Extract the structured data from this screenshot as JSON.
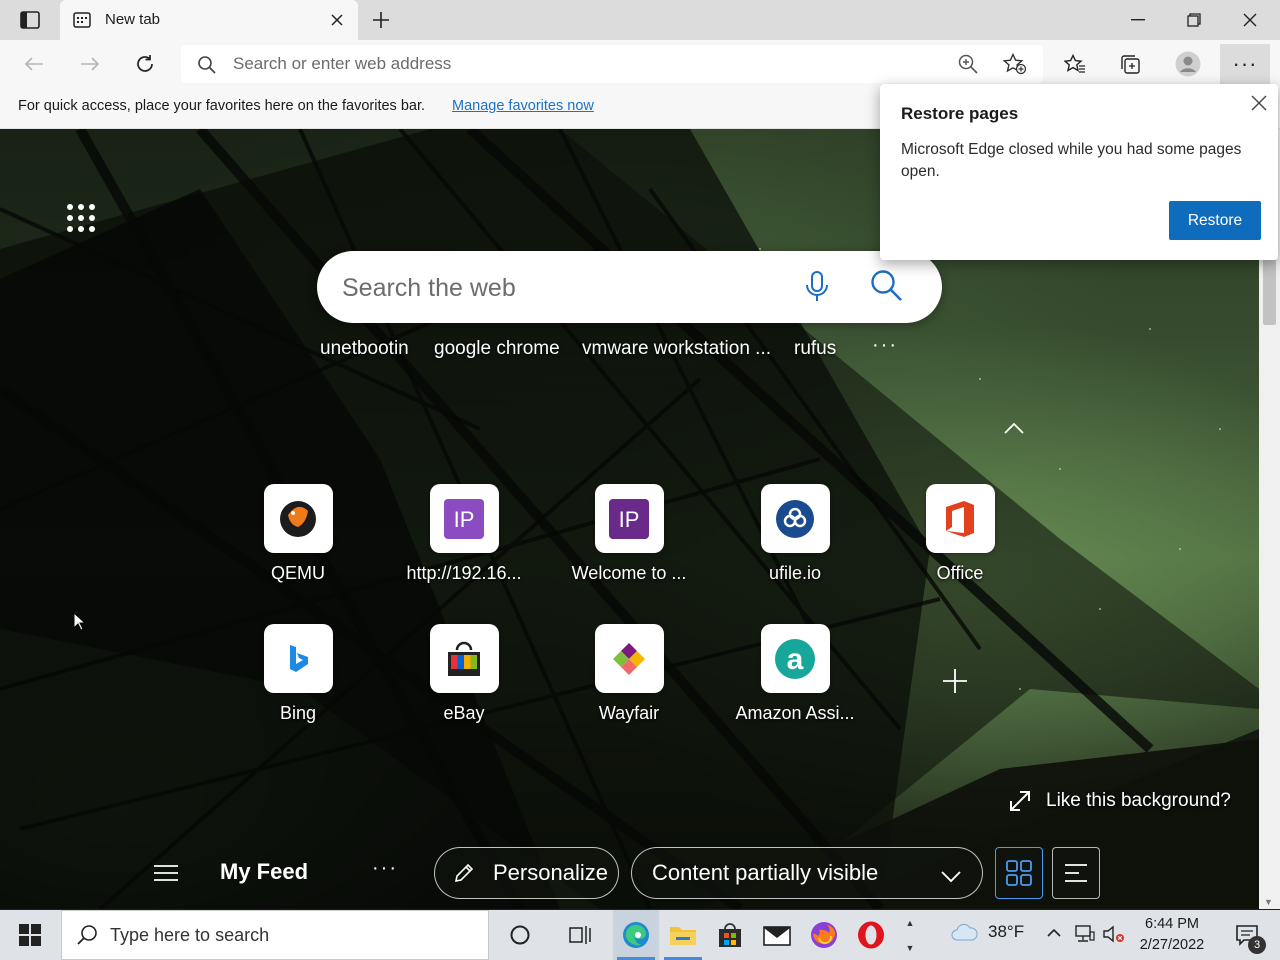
{
  "browser": {
    "tab": {
      "title": "New tab"
    },
    "address_bar": {
      "placeholder": "Search or enter web address"
    },
    "favorites_bar": {
      "message": "For quick access, place your favorites here on the favorites bar.",
      "link": "Manage favorites now"
    }
  },
  "new_tab_page": {
    "search": {
      "placeholder": "Search the web"
    },
    "trending": [
      "unetbootin",
      "google chrome",
      "vmware workstation ...",
      "rufus"
    ],
    "trending_more": "···",
    "quick_links": [
      {
        "label": "QEMU",
        "icon": "qemu-icon"
      },
      {
        "label": "http://192.16...",
        "icon": "ip-icon"
      },
      {
        "label": "Welcome to ...",
        "icon": "ip-icon"
      },
      {
        "label": "ufile.io",
        "icon": "ufile-icon"
      },
      {
        "label": "Office",
        "icon": "office-icon"
      },
      {
        "label": "Bing",
        "icon": "bing-icon"
      },
      {
        "label": "eBay",
        "icon": "ebay-icon"
      },
      {
        "label": "Wayfair",
        "icon": "wayfair-icon"
      },
      {
        "label": "Amazon Assi...",
        "icon": "amazon-assistant-icon"
      }
    ],
    "like_background": "Like this background?",
    "feed": {
      "title": "My Feed",
      "more": "···",
      "personalize": "Personalize",
      "content_visibility": "Content partially visible"
    }
  },
  "restore_popup": {
    "title": "Restore pages",
    "message": "Microsoft Edge closed while you had some pages open.",
    "button": "Restore"
  },
  "taskbar": {
    "search_placeholder": "Type here to search",
    "weather": "38°F",
    "time": "6:44 PM",
    "date": "2/27/2022",
    "notification_count": "3"
  },
  "colors": {
    "accent": "#0f6cbd",
    "link": "#1a73c9",
    "ip_purple": "#7b3fa8"
  }
}
